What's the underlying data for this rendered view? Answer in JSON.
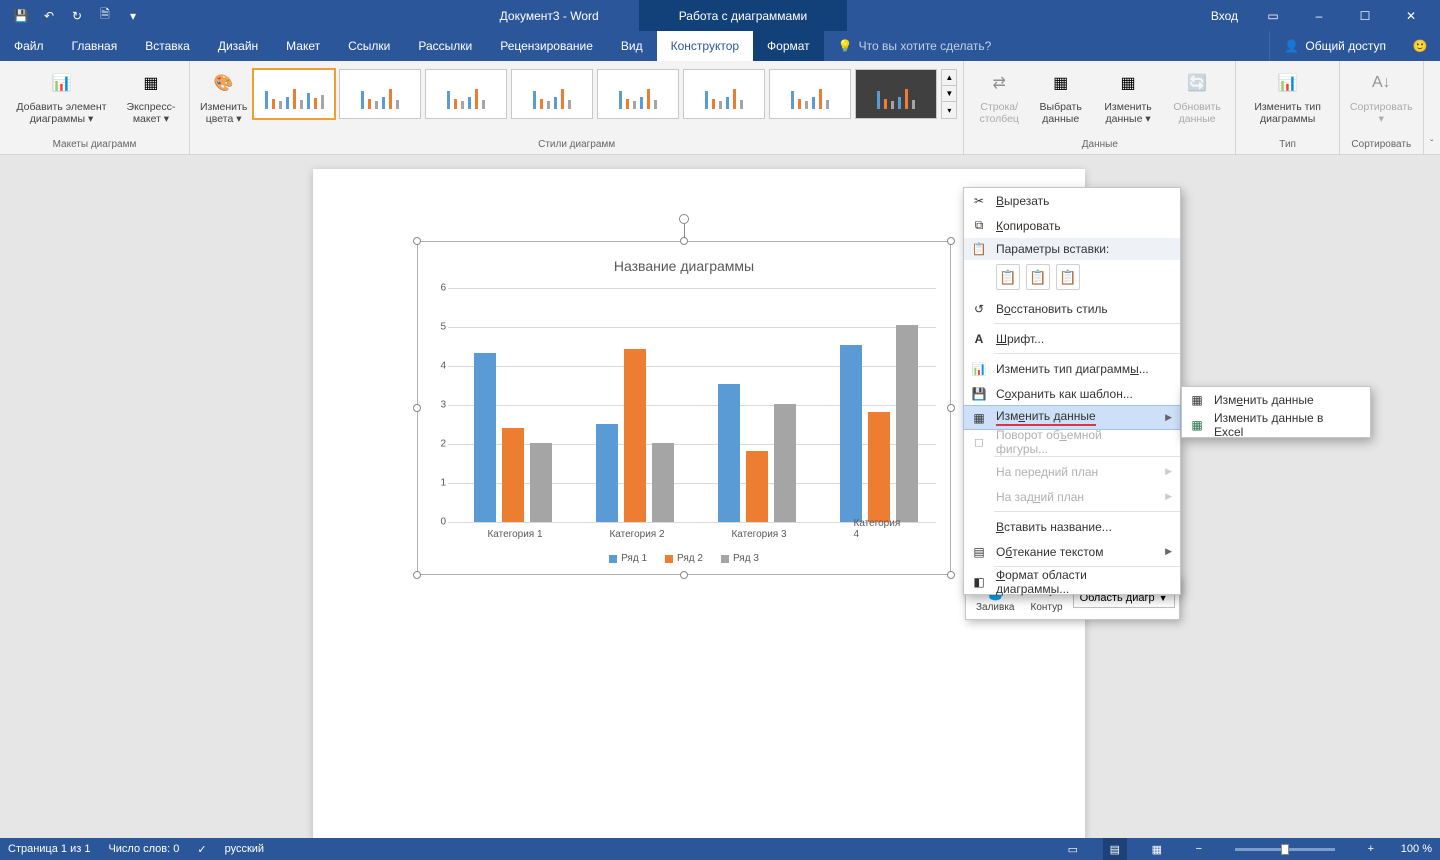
{
  "titlebar": {
    "document_title": "Документ3 - Word",
    "chart_tools_title": "Работа с диаграммами",
    "login": "Вход"
  },
  "ribbon_tabs": {
    "file": "Файл",
    "home": "Главная",
    "insert": "Вставка",
    "design": "Дизайн",
    "layout": "Макет",
    "references": "Ссылки",
    "mailings": "Рассылки",
    "review": "Рецензирование",
    "view": "Вид",
    "constructor": "Конструктор",
    "format": "Формат",
    "tell_me": "Что вы хотите сделать?",
    "share": "Общий доступ"
  },
  "ribbon": {
    "layouts_group": "Макеты диаграмм",
    "add_element": "Добавить элемент диаграммы ▾",
    "express_layout": "Экспресс-макет ▾",
    "change_colors": "Изменить цвета ▾",
    "styles_group": "Стили диаграмм",
    "row_column": "Строка/столбец",
    "select_data": "Выбрать данные",
    "edit_data": "Изменить данные ▾",
    "refresh_data": "Обновить данные",
    "data_group": "Данные",
    "change_type": "Изменить тип диаграммы",
    "type_group": "Тип",
    "sort": "Сортировать ▾",
    "sort_group": "Сортировать"
  },
  "context_menu": {
    "cut": "Вырезать",
    "copy": "Копировать",
    "paste_options": "Параметры вставки:",
    "reset_style": "Восстановить стиль",
    "font": "Шрифт...",
    "change_chart_type": "Изменить тип диаграммы...",
    "save_as_template": "Сохранить как шаблон...",
    "edit_data": "Изменить данные",
    "rotate_3d": "Поворот объемной фигуры...",
    "bring_front": "На передний план",
    "send_back": "На задний план",
    "insert_caption": "Вставить название...",
    "text_wrap": "Обтекание текстом",
    "format_chart_area": "Формат области диаграммы..."
  },
  "submenu": {
    "edit_data": "Изменить данные",
    "edit_data_excel": "Изменить данные в Excel"
  },
  "mini_toolbar": {
    "fill": "Заливка",
    "outline": "Контур",
    "area_select": "Область диагр"
  },
  "chart_data": {
    "type": "bar",
    "title": "Название диаграммы",
    "categories": [
      "Категория 1",
      "Категория 2",
      "Категория 3",
      "Категория 4"
    ],
    "series": [
      {
        "name": "Ряд 1",
        "values": [
          4.3,
          2.5,
          3.5,
          4.5
        ]
      },
      {
        "name": "Ряд 2",
        "values": [
          2.4,
          4.4,
          1.8,
          2.8
        ]
      },
      {
        "name": "Ряд 3",
        "values": [
          2.0,
          2.0,
          3.0,
          5.0
        ]
      }
    ],
    "ylim": [
      0,
      6
    ],
    "y_ticks": [
      0,
      1,
      2,
      3,
      4,
      5,
      6
    ],
    "colors": {
      "s1": "#5b9bd5",
      "s2": "#ed7d31",
      "s3": "#a5a5a5"
    }
  },
  "statusbar": {
    "page": "Страница 1 из 1",
    "words": "Число слов: 0",
    "language": "русский",
    "zoom": "100 %"
  }
}
